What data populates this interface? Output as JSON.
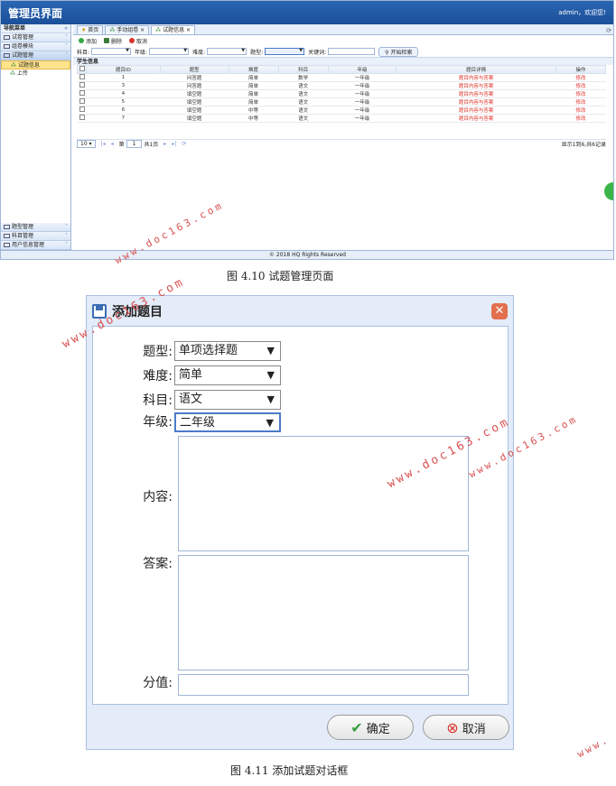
{
  "app": {
    "title": "管理员界面",
    "user": "admin，欢迎您!"
  },
  "sidebar": {
    "header": "导航菜单",
    "collapse": "«",
    "items": [
      {
        "label": "试卷管理"
      },
      {
        "label": "组卷模块"
      },
      {
        "label": "试题管理"
      }
    ],
    "sub": [
      {
        "label": "试题信息"
      },
      {
        "label": "上传"
      }
    ],
    "bottom": [
      {
        "label": "题型管理"
      },
      {
        "label": "科目管理"
      },
      {
        "label": "用户信息管理"
      }
    ]
  },
  "tabs": [
    {
      "label": "首页"
    },
    {
      "label": "手动组卷 ×"
    },
    {
      "label": "试题信息 ×"
    }
  ],
  "toolbar": {
    "add": "添加",
    "delete": "删除",
    "cancel": "取消"
  },
  "filters": {
    "subject": "科目:",
    "grade": "年级:",
    "difficulty": "难度:",
    "type": "题型:",
    "keyword": "关键词:",
    "search": "开始检索"
  },
  "grid": {
    "title": "学生信息",
    "columns": [
      "题目ID",
      "题型",
      "难度",
      "科目",
      "年级",
      "题目详情",
      "操作"
    ],
    "rows": [
      [
        "1",
        "问答题",
        "简单",
        "数学",
        "一年级",
        "题目内容与答案",
        "修改"
      ],
      [
        "3",
        "问答题",
        "简单",
        "语文",
        "一年级",
        "题目内容与答案",
        "修改"
      ],
      [
        "4",
        "填空题",
        "简单",
        "语文",
        "一年级",
        "题目内容与答案",
        "修改"
      ],
      [
        "5",
        "填空题",
        "简单",
        "语文",
        "一年级",
        "题目内容与答案",
        "修改"
      ],
      [
        "6",
        "填空题",
        "中等",
        "语文",
        "一年级",
        "题目内容与答案",
        "修改"
      ],
      [
        "7",
        "填空题",
        "中等",
        "语文",
        "一年级",
        "题目内容与答案",
        "修改"
      ]
    ]
  },
  "pager": {
    "size": "10 ▾",
    "page": "第",
    "pageval": "1",
    "total": "共1页",
    "summary": "显示1到6,共6记录"
  },
  "footer": "© 2018 HQ Rights Reserved",
  "caption1": "图 4.10 试题管理页面",
  "dialog": {
    "title": "添加题目",
    "close": "✕",
    "fields": {
      "type": "题型:",
      "type_val": "单项选择题",
      "difficulty": "难度:",
      "difficulty_val": "简单",
      "subject": "科目:",
      "subject_val": "语文",
      "grade": "年级:",
      "grade_val": "二年级",
      "content": "内容:",
      "answer": "答案:",
      "score": "分值:"
    },
    "ok": "确定",
    "cancel": "取消"
  },
  "caption2": "图 4.11 添加试题对话框",
  "watermark": "www.doc163.com",
  "watermark_short": "www."
}
